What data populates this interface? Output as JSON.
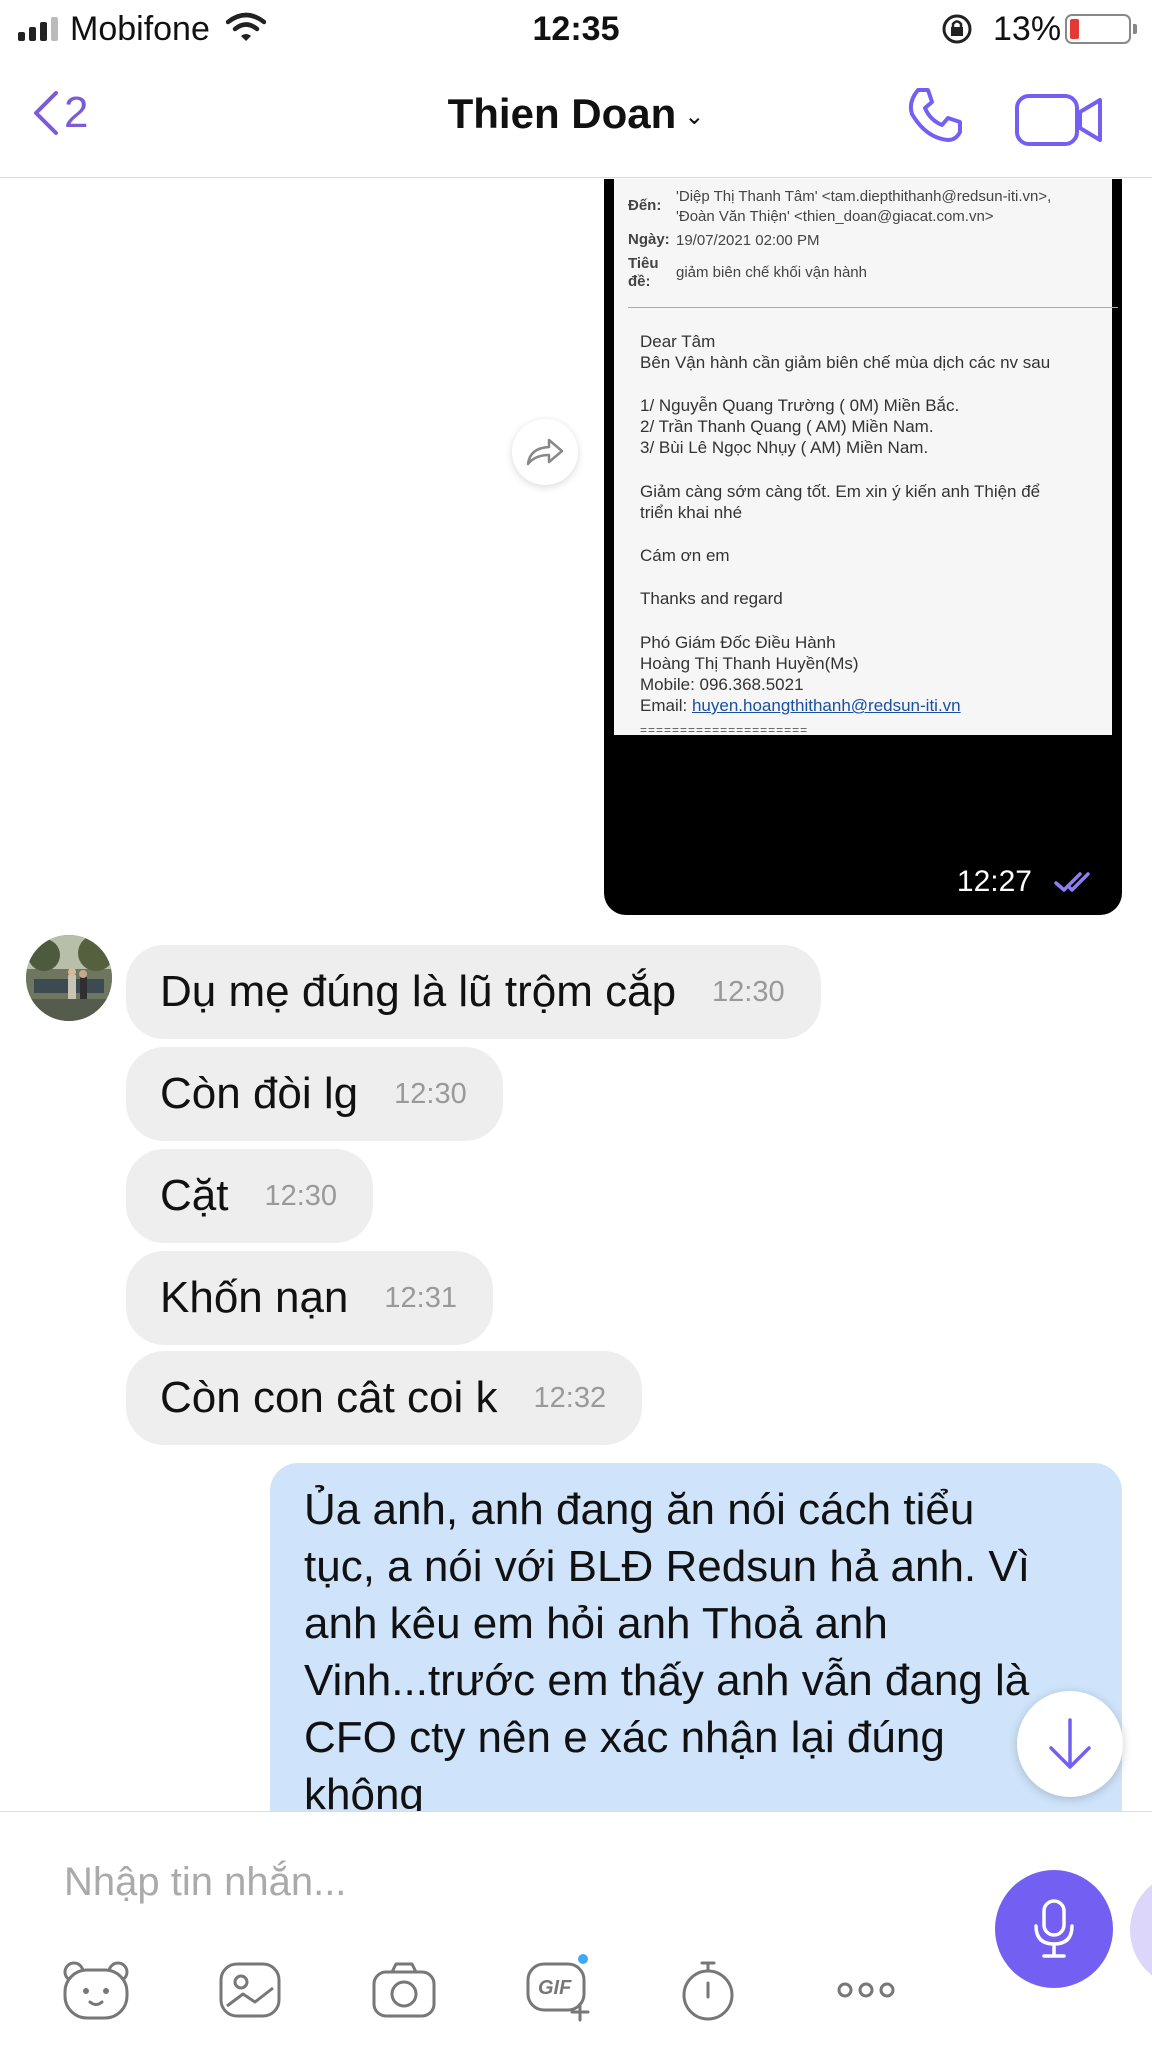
{
  "status_bar": {
    "carrier": "Mobifone",
    "time": "12:35",
    "battery_percent": "13%",
    "battery_level": 0.13
  },
  "header": {
    "back_count": "2",
    "contact_name": "Thien Doan",
    "icons": [
      "chevron-left-icon",
      "chevron-down-icon",
      "phone-icon",
      "video-camera-icon"
    ]
  },
  "image_message": {
    "email": {
      "to_label": "Đến:",
      "to_value_1": "'Diệp Thị Thanh Tâm' <tam.diepthithanh@redsun-iti.vn>,",
      "to_value_2": "'Đoàn Văn Thiện' <thien_doan@giacat.com.vn>",
      "date_label": "Ngày:",
      "date_value": "19/07/2021 02:00 PM",
      "subject_label_1": "Tiêu",
      "subject_label_2": "đề:",
      "subject_value": "giảm biên chế khối vận hành",
      "body": [
        "Dear Tâm",
        "Bên Vận hành cần giảm biên chế mùa dịch các nv sau",
        "1/ Nguyễn Quang Trường ( 0M) Miền Bắc.",
        "2/ Trần Thanh Quang ( AM) Miền Nam.",
        "3/ Bùi Lê Ngọc Nhụy ( AM) Miền Nam.",
        "Giảm càng sớm càng tốt. Em xin ý kiến anh Thiện để",
        "triển khai nhé",
        "Cám ơn em",
        "Thanks and regard",
        "Phó Giám Đốc Điều Hành",
        "Hoàng Thị Thanh Huyền(Ms)",
        "Mobile: 096.368.5021",
        "Email:",
        "huyen.hoangthithanh@redsun-iti.vn",
        "====================="
      ]
    },
    "time": "12:27"
  },
  "incoming_messages": [
    {
      "text": "Dụ mẹ đúng là lũ trộm cắp",
      "time": "12:30"
    },
    {
      "text": "Còn đòi lg",
      "time": "12:30"
    },
    {
      "text": "Cặt",
      "time": "12:30"
    },
    {
      "text": "Khốn nạn",
      "time": "12:31"
    },
    {
      "text": "Còn con cât coi k",
      "time": "12:32"
    }
  ],
  "outgoing_message": {
    "lines": [
      "Ủa anh, anh đang ăn nói cách tiểu",
      "tục, a nói với BLĐ Redsun hả anh. Vì",
      "anh kêu em hỏi anh Thoả anh",
      "Vinh...trước em thấy anh vẫn đang là",
      "CFO cty nên e xác nhận lại đúng",
      "không"
    ]
  },
  "composer": {
    "placeholder": "Nhập tin nhắn...",
    "tools": [
      "sticker-icon",
      "gallery-icon",
      "camera-icon",
      "gif-icon",
      "timer-icon",
      "more-icon"
    ]
  },
  "colors": {
    "accent": "#7360f2",
    "outgoing_bubble": "#cfe4fb",
    "incoming_bubble": "#eeeeee"
  }
}
